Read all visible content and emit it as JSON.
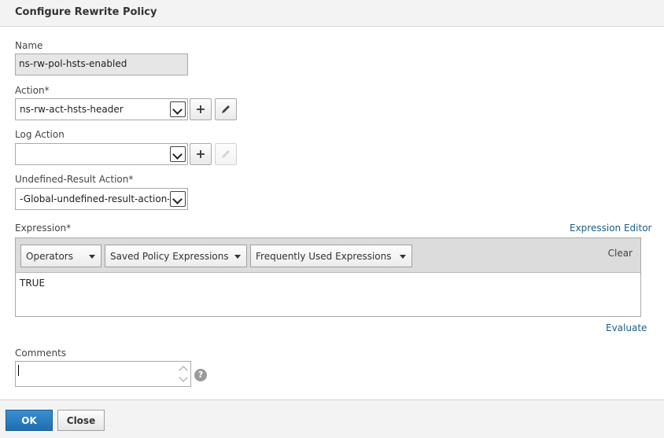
{
  "dialog": {
    "title": "Configure Rewrite Policy"
  },
  "name": {
    "label": "Name",
    "value": "ns-rw-pol-hsts-enabled"
  },
  "action": {
    "label": "Action*",
    "value": "ns-rw-act-hsts-header",
    "add_icon": "plus-icon",
    "edit_icon": "pencil-icon"
  },
  "log_action": {
    "label": "Log Action",
    "value": "",
    "add_icon": "plus-icon",
    "edit_icon": "pencil-icon"
  },
  "undefined_result": {
    "label": "Undefined-Result Action*",
    "value": "-Global-undefined-result-action-"
  },
  "expression": {
    "label": "Expression*",
    "editor_link": "Expression Editor",
    "operators": "Operators",
    "saved": "Saved Policy Expressions",
    "frequent": "Frequently Used Expressions",
    "clear": "Clear",
    "value": "TRUE",
    "evaluate_link": "Evaluate"
  },
  "comments": {
    "label": "Comments",
    "value": "",
    "help_icon": "question-icon",
    "help_glyph": "?"
  },
  "footer": {
    "ok": "OK",
    "close": "Close"
  },
  "colors": {
    "primary_button": "#2a7fc3",
    "link": "#1c5d8c",
    "header_bg": "#f3f3f3"
  }
}
